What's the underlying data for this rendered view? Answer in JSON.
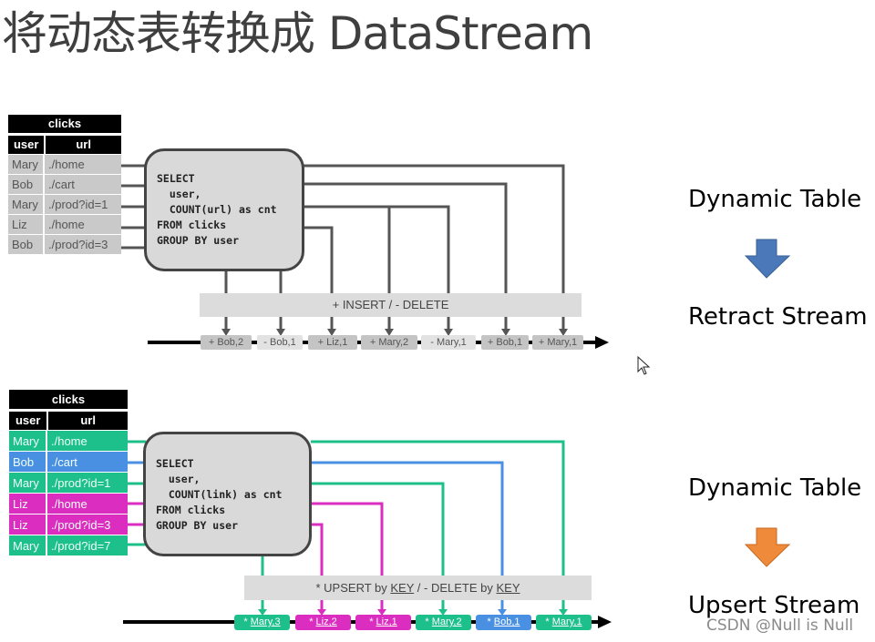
{
  "title": "将动态表转换成 DataStream",
  "colors": {
    "retract_label": "#5b8fd0",
    "upsert_label": "#b3122a",
    "retract_arrow": "#4a78b8",
    "upsert_arrow": "#ee8a3a",
    "green": "#1dbf8a",
    "blue": "#4a90e2",
    "magenta": "#db2ec0",
    "insert_chip": "#c4c4c4",
    "delete_chip": "#e2e2e2"
  },
  "retract_section": {
    "table": {
      "name": "clicks",
      "columns": [
        "user",
        "url"
      ],
      "rows": [
        {
          "user": "Mary",
          "url": "./home"
        },
        {
          "user": "Bob",
          "url": "./cart"
        },
        {
          "user": "Mary",
          "url": "./prod?id=1"
        },
        {
          "user": "Liz",
          "url": "./home"
        },
        {
          "user": "Bob",
          "url": "./prod?id=3"
        }
      ]
    },
    "query": "SELECT\n  user,\n  COUNT(url) as cnt\nFROM clicks\nGROUP BY user",
    "bar_label": "+ INSERT / - DELETE",
    "stream": [
      {
        "label": "+ Bob,2",
        "kind": "insert"
      },
      {
        "label": "- Bob,1",
        "kind": "delete"
      },
      {
        "label": "+ Liz,1",
        "kind": "insert"
      },
      {
        "label": "+ Mary,2",
        "kind": "insert"
      },
      {
        "label": "- Mary,1",
        "kind": "delete"
      },
      {
        "label": "+ Bob,1",
        "kind": "insert"
      },
      {
        "label": "+ Mary,1",
        "kind": "insert"
      }
    ],
    "from_label": "Dynamic Table",
    "to_label": "Retract Stream"
  },
  "upsert_section": {
    "table": {
      "name": "clicks",
      "columns": [
        "user",
        "url"
      ],
      "rows": [
        {
          "user": "Mary",
          "url": "./home",
          "color": "green"
        },
        {
          "user": "Bob",
          "url": "./cart",
          "color": "blue"
        },
        {
          "user": "Mary",
          "url": "./prod?id=1",
          "color": "green"
        },
        {
          "user": "Liz",
          "url": "./home",
          "color": "magenta"
        },
        {
          "user": "Liz",
          "url": "./prod?id=3",
          "color": "magenta"
        },
        {
          "user": "Mary",
          "url": "./prod?id=7",
          "color": "green"
        }
      ]
    },
    "query": "SELECT\n  user,\n  COUNT(link) as cnt\nFROM clicks\nGROUP BY user",
    "bar_label_parts": [
      "* UPSERT by ",
      "KEY",
      " / - DELETE by ",
      "KEY"
    ],
    "stream": [
      {
        "prefix": "* ",
        "label": "Mary,3",
        "color": "green"
      },
      {
        "prefix": "* ",
        "label": "Liz,2",
        "color": "magenta"
      },
      {
        "prefix": "* ",
        "label": "Liz,1",
        "color": "magenta"
      },
      {
        "prefix": "* ",
        "label": "Mary,2",
        "color": "green"
      },
      {
        "prefix": "* ",
        "label": "Bob,1",
        "color": "blue"
      },
      {
        "prefix": "* ",
        "label": "Mary,1",
        "color": "green"
      }
    ],
    "from_label": "Dynamic Table",
    "to_label": "Upsert Stream"
  },
  "watermark": "CSDN @Null is Null"
}
